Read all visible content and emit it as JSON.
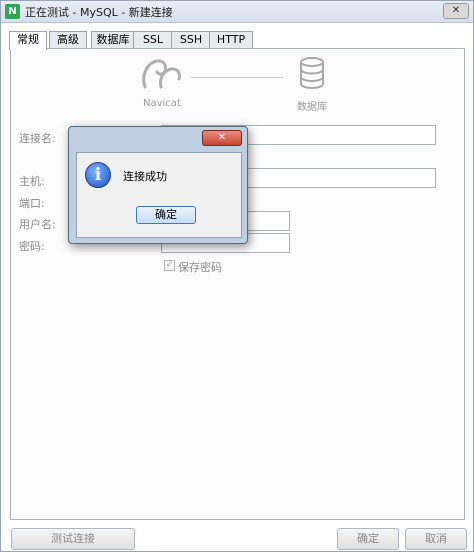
{
  "window": {
    "title": "正在测试 - MySQL - 新建连接",
    "app_icon": "navicat-icon",
    "close_label": "✕"
  },
  "tabs": [
    "常规",
    "高级",
    "数据库",
    "SSL",
    "SSH",
    "HTTP"
  ],
  "active_tab": "常规",
  "diagram": {
    "left_caption": "Navicat",
    "right_caption": "数据库"
  },
  "form": {
    "connection_name_label": "连接名:",
    "host_label": "主机:",
    "port_label": "端口:",
    "username_label": "用户名:",
    "password_label": "密码:",
    "save_password_label": "保存密码",
    "save_password_checked": true
  },
  "footer": {
    "test_button": "测试连接",
    "ok_button": "确定",
    "cancel_button": "取消"
  },
  "dialog": {
    "message": "连接成功",
    "ok_button": "确定",
    "close_label": "✕",
    "icon": "info-icon"
  }
}
